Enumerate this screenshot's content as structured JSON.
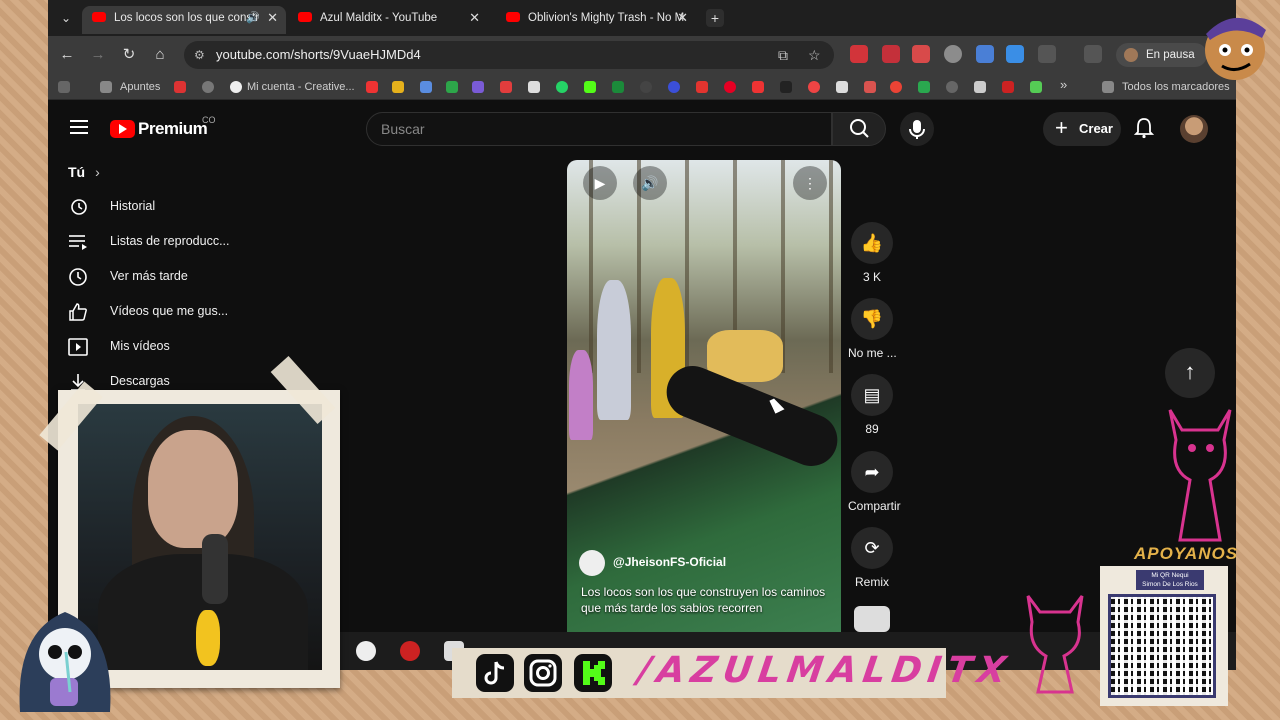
{
  "browser": {
    "tabs": [
      {
        "title": "Los locos son los que constr",
        "active": true,
        "audio": true
      },
      {
        "title": "Azul Malditx - YouTube",
        "active": false
      },
      {
        "title": "Oblivion's Mighty Trash - No M",
        "active": false
      }
    ],
    "url": "youtube.com/shorts/9VuaeHJMDd4",
    "profile_label": "En pausa",
    "bookmarks": {
      "items": [
        "Apuntes",
        "Mi cuenta - Creative..."
      ],
      "all_bookmarks": "Todos los marcadores"
    }
  },
  "youtube": {
    "logo_text": "Premium",
    "country_code": "CO",
    "search_placeholder": "Buscar",
    "create_label": "Crear",
    "sidebar": {
      "section": "Tú",
      "items": [
        {
          "label": "Historial",
          "icon": "history-icon"
        },
        {
          "label": "Listas de reproducc...",
          "icon": "playlist-icon"
        },
        {
          "label": "Ver más tarde",
          "icon": "clock-icon"
        },
        {
          "label": "Vídeos que me gus...",
          "icon": "thumbs-up-icon"
        },
        {
          "label": "Mis vídeos",
          "icon": "my-videos-icon"
        },
        {
          "label": "Descargas",
          "icon": "download-icon"
        }
      ]
    },
    "short": {
      "channel": "@JheisonFS-Oficial",
      "title": "Los locos son los que construyen los caminos que más tarde los sabios recorren"
    },
    "actions": {
      "like_count": "3 K",
      "dislike_label": "No me ...",
      "comments_count": "89",
      "share_label": "Compartir",
      "remix_label": "Remix"
    }
  },
  "overlay": {
    "brand": "/AZULMALDITX",
    "apoyanos": "APOYANOS",
    "qr_caption_line1": "Mi QR Nequi",
    "qr_caption_line2": "Simon De Los Rios"
  }
}
